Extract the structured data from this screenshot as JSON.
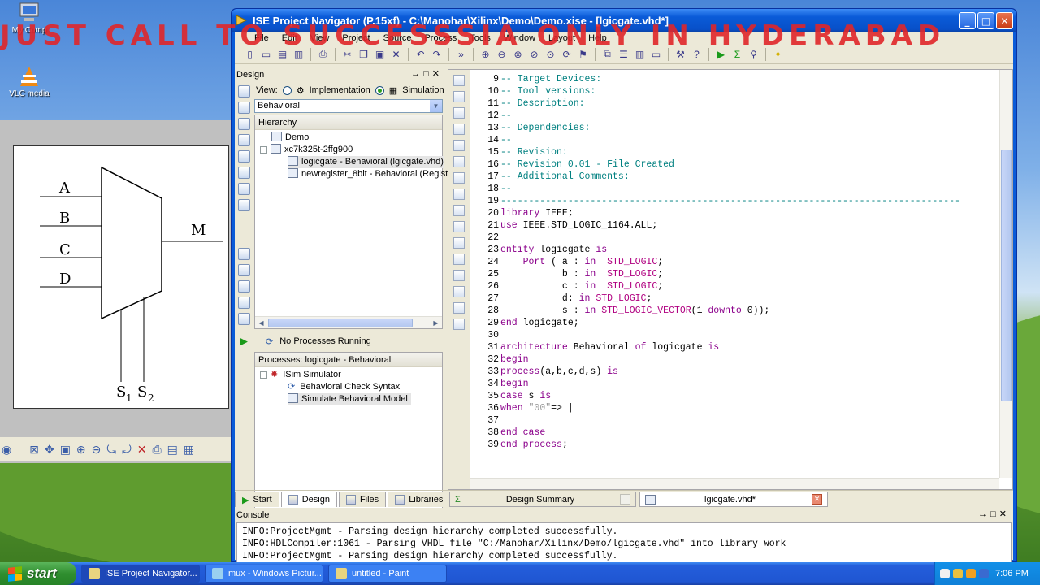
{
  "banner": "JUST CALL TO SUCCESSSIA ONLY IN HYDERABAD",
  "desktop": {
    "icons": [
      {
        "label": "My Comp"
      },
      {
        "label": "VLC media"
      }
    ]
  },
  "paint_diagram": {
    "inputs": [
      "A",
      "B",
      "C",
      "D"
    ],
    "output": "M",
    "selects": [
      "S",
      "S"
    ],
    "select_subs": [
      "1",
      "2"
    ]
  },
  "window": {
    "title": "ISE Project Navigator (P.15xf) - C:\\Manohar\\Xilinx\\Demo\\Demo.xise - [lgicgate.vhd*]"
  },
  "menu": [
    "File",
    "Edit",
    "View",
    "Project",
    "Source",
    "Process",
    "Tools",
    "Window",
    "Layout",
    "Help"
  ],
  "design_panel": {
    "title": "Design",
    "view_label": "View:",
    "implementation": "Implementation",
    "simulation": "Simulation",
    "combo_value": "Behavioral",
    "hierarchy_title": "Hierarchy",
    "tree": [
      {
        "label": "Demo"
      },
      {
        "label": "xc7k325t-2ffg900"
      },
      {
        "label": "logicgate - Behavioral (lgicgate.vhd)"
      },
      {
        "label": "newregister_8bit - Behavioral (Registe"
      }
    ],
    "process_status": "No Processes Running",
    "processes_title": "Processes: logicgate - Behavioral",
    "processes": [
      {
        "label": "ISim Simulator"
      },
      {
        "label": "Behavioral Check Syntax"
      },
      {
        "label": "Simulate Behavioral Model"
      }
    ]
  },
  "bottom_tabs": [
    "Start",
    "Design",
    "Files",
    "Libraries"
  ],
  "file_tabs": [
    "Design Summary",
    "lgicgate.vhd*"
  ],
  "editor": {
    "line_numbers": [
      "9",
      "10",
      "11",
      "12",
      "13",
      "14",
      "15",
      "16",
      "17",
      "18",
      "19",
      "20",
      "21",
      "22",
      "23",
      "24",
      "25",
      "26",
      "27",
      "28",
      "29",
      "30",
      "31",
      "32",
      "33",
      "34",
      "35",
      "36",
      "37",
      "38",
      "39"
    ],
    "lines": [
      "-- Target Devices:",
      "-- Tool versions:",
      "-- Description:",
      "--",
      "-- Dependencies:",
      "--",
      "-- Revision:",
      "-- Revision 0.01 - File Created",
      "-- Additional Comments:",
      "--",
      "----------------------------------------------------------------------------------",
      "library IEEE;",
      "use IEEE.STD_LOGIC_1164.ALL;",
      "",
      "entity logicgate is",
      "    Port ( a : in  STD_LOGIC;",
      "           b : in  STD_LOGIC;",
      "           c : in  STD_LOGIC;",
      "           d: in STD_LOGIC;",
      "           s : in STD_LOGIC_VECTOR(1 downto 0));",
      "end logicgate;",
      "",
      "architecture Behavioral of logicgate is",
      "begin",
      "process(a,b,c,d,s) is",
      "begin",
      "case s is",
      "when \"00\"=> |",
      "",
      "end case",
      "end process;"
    ]
  },
  "console": {
    "title": "Console",
    "lines": [
      "INFO:ProjectMgmt - Parsing design hierarchy completed successfully.",
      "INFO:HDLCompiler:1061 - Parsing VHDL file \"C:/Manohar/Xilinx/Demo/lgicgate.vhd\" into library work",
      "INFO:ProjectMgmt - Parsing design hierarchy completed successfully."
    ]
  },
  "taskbar": {
    "start": "start",
    "tasks": [
      "ISE Project Navigator...",
      "mux - Windows Pictur...",
      "untitled - Paint"
    ],
    "clock": "7:06 PM"
  }
}
